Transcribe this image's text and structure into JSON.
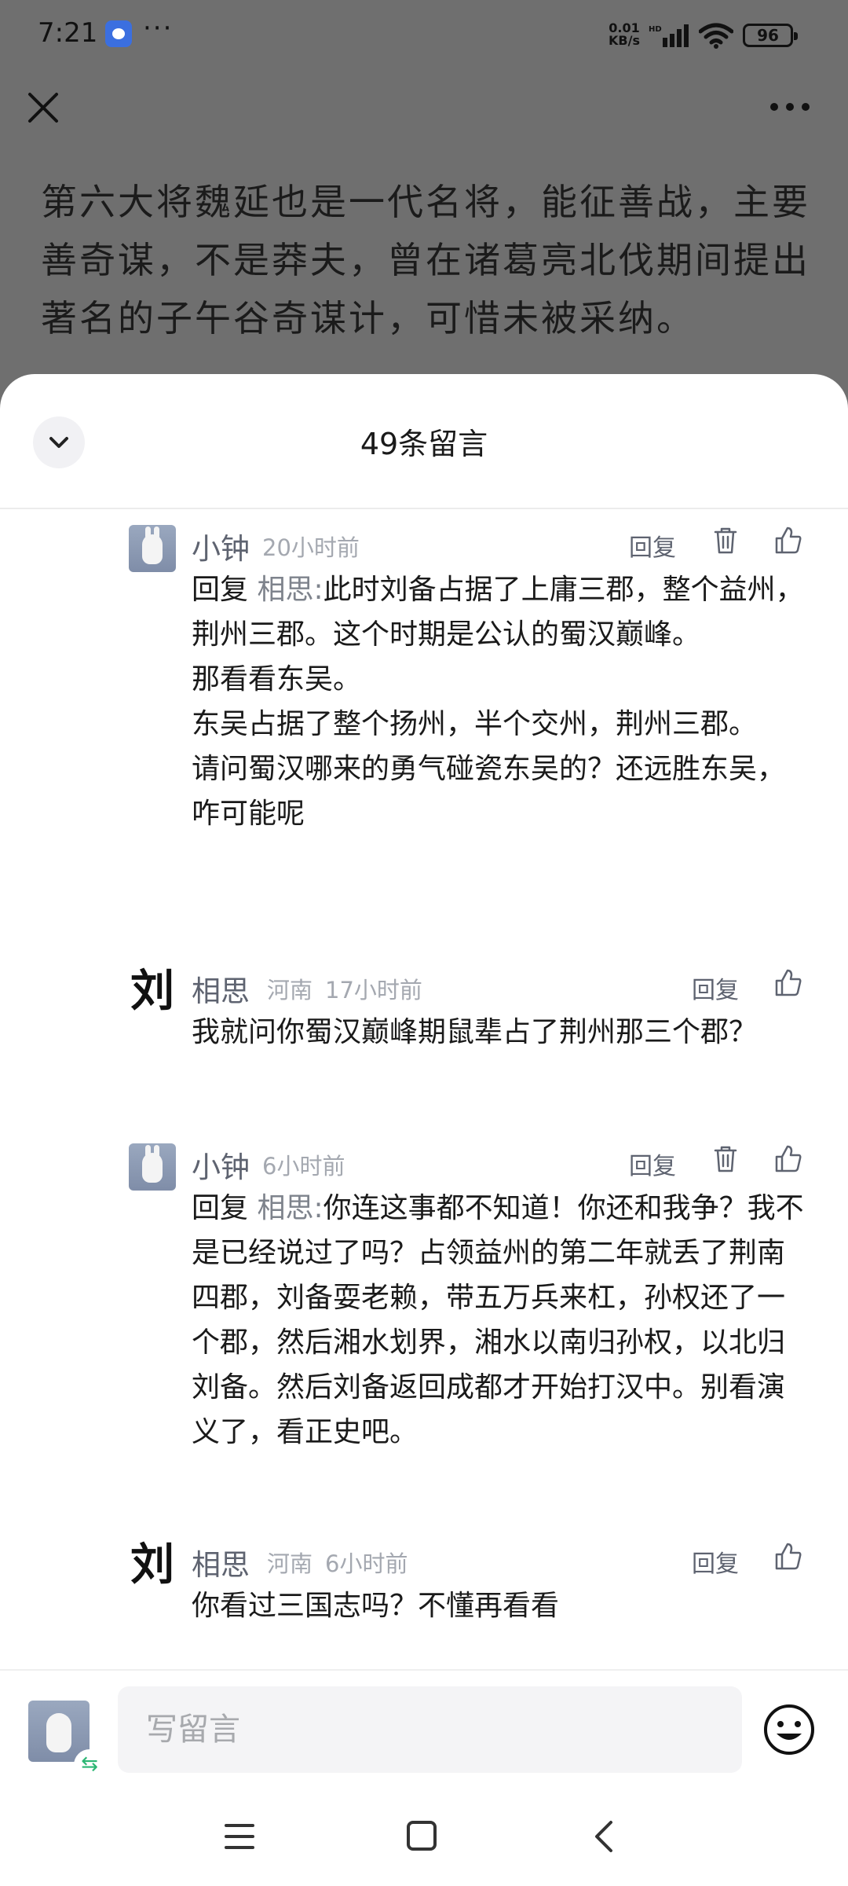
{
  "status_bar": {
    "time": "7:21",
    "dots": "···",
    "net_speed_value": "0.01",
    "net_speed_unit": "KB/s",
    "battery": "96"
  },
  "article": {
    "text": "第六大将魏延也是一代名将，能征善战，主要善奇谋，不是莽夫，曾在诸葛亮北伐期间提出著名的子午谷奇谋计，可惜未被采纳。"
  },
  "sheet": {
    "title": "49条留言"
  },
  "comments": [
    {
      "name": "小钟",
      "location": "",
      "time": "20小时前",
      "reply_label": "回复",
      "reply_prefix": "回复",
      "reply_target": "相思:",
      "paragraphs": [
        "此时刘备占据了上庸三郡，整个益州，荆州三郡。这个时期是公认的蜀汉巅峰。",
        "那看看东吴。",
        "东吴占据了整个扬州，半个交州，荆州三郡。",
        "请问蜀汉哪来的勇气碰瓷东吴的？还远胜东吴，咋可能呢"
      ]
    },
    {
      "name": "相思",
      "avatar_char": "刘",
      "location": "河南",
      "time": "17小时前",
      "reply_label": "回复",
      "paragraphs": [
        "我就问你蜀汉巅峰期鼠辈占了荆州那三个郡？"
      ]
    },
    {
      "name": "小钟",
      "location": "",
      "time": "6小时前",
      "reply_label": "回复",
      "reply_prefix": "回复",
      "reply_target": "相思:",
      "paragraphs": [
        "你连这事都不知道！你还和我争？我不是已经说过了吗？占领益州的第二年就丢了荆南四郡，刘备耍老赖，带五万兵来杠，孙权还了一个郡，然后湘水划界，湘水以南归孙权，以北归刘备。然后刘备返回成都才开始打汉中。别看演义了，看正史吧。"
      ]
    },
    {
      "name": "相思",
      "avatar_char": "刘",
      "location": "河南",
      "time": "6小时前",
      "reply_label": "回复",
      "paragraphs": [
        "你看过三国志吗？不懂再看看"
      ]
    }
  ],
  "input": {
    "placeholder": "写留言",
    "value": "",
    "switch_glyph": "⇆"
  },
  "icons": {
    "close": "close-icon",
    "more": "more-icon",
    "collapse": "chevron-down-icon",
    "delete": "trash-icon",
    "like": "thumbs-up-icon",
    "emoji": "emoji-icon",
    "nav_menu": "menu-icon",
    "nav_home": "home-icon",
    "nav_back": "back-icon"
  },
  "colors": {
    "scrim": "#6f6f6f",
    "sheet": "#ffffff",
    "name": "#5e6370",
    "meta": "#a4a8b0",
    "accent_switch": "#2bb673"
  }
}
